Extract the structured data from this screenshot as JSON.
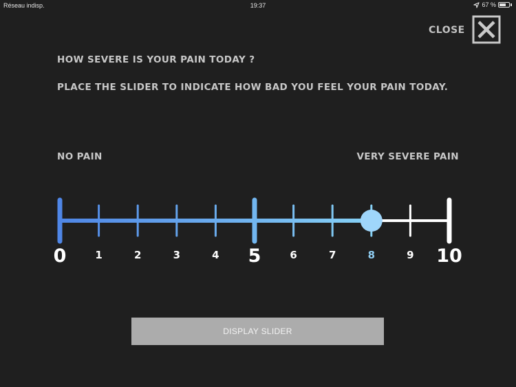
{
  "status_bar": {
    "carrier": "Réseau indisp.",
    "time": "19:37",
    "battery_text": "67 %",
    "battery_level": 0.67,
    "location_icon": "location-arrow-icon",
    "battery_icon": "battery-icon"
  },
  "header": {
    "close_label": "CLOSE",
    "close_icon": "close-x-box-icon"
  },
  "question": {
    "title": "HOW SEVERE IS YOUR PAIN TODAY ?",
    "instruction": "PLACE THE SLIDER TO INDICATE HOW BAD YOU FEEL YOUR PAIN TODAY."
  },
  "scale": {
    "min_label": "NO PAIN",
    "max_label": "VERY SEVERE PAIN",
    "ticks": [
      "0",
      "1",
      "2",
      "3",
      "4",
      "5",
      "6",
      "7",
      "8",
      "9",
      "10"
    ],
    "major_ticks": [
      "0",
      "5",
      "10"
    ],
    "min": 0,
    "max": 10,
    "value": 8,
    "colors": {
      "track_start": "#4f86e6",
      "track_end": "#87d2f6",
      "track_rest": "#ffffff",
      "thumb": "#9fd6fb",
      "selected_label": "#8fcdf2"
    }
  },
  "actions": {
    "display_slider_label": "DISPLAY SLIDER"
  }
}
